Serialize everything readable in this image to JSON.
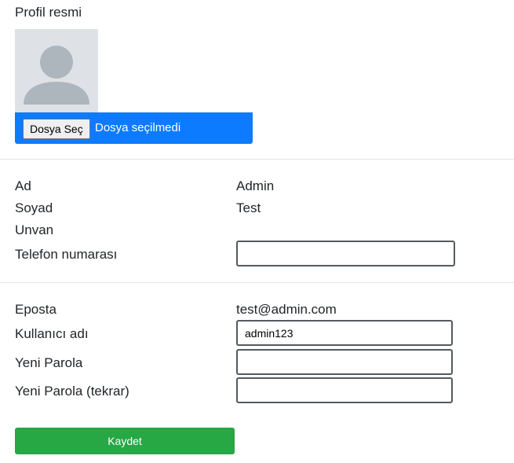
{
  "profile_photo": {
    "label": "Profil resmi",
    "avatar_icon": "user-silhouette-icon",
    "choose_file_label": "Dosya Seç",
    "file_status": "Dosya seçilmedi",
    "colors": {
      "avatar_bg": "#dee2e6",
      "avatar_silhouette": "#adb5bd",
      "file_bar_bg": "#0d7bff"
    }
  },
  "personal": {
    "first_name_label": "Ad",
    "first_name_value": "Admin",
    "last_name_label": "Soyad",
    "last_name_value": "Test",
    "title_label": "Unvan",
    "title_value": "",
    "phone_label": "Telefon numarası",
    "phone_value": ""
  },
  "account": {
    "email_label": "Eposta",
    "email_value": "test@admin.com",
    "username_label": "Kullanıcı adı",
    "username_value": "admin123",
    "new_password_label": "Yeni Parola",
    "new_password_value": "",
    "new_password_repeat_label": "Yeni Parola (tekrar)",
    "new_password_repeat_value": ""
  },
  "save_button": {
    "label": "Kaydet",
    "color": "#28a745"
  }
}
